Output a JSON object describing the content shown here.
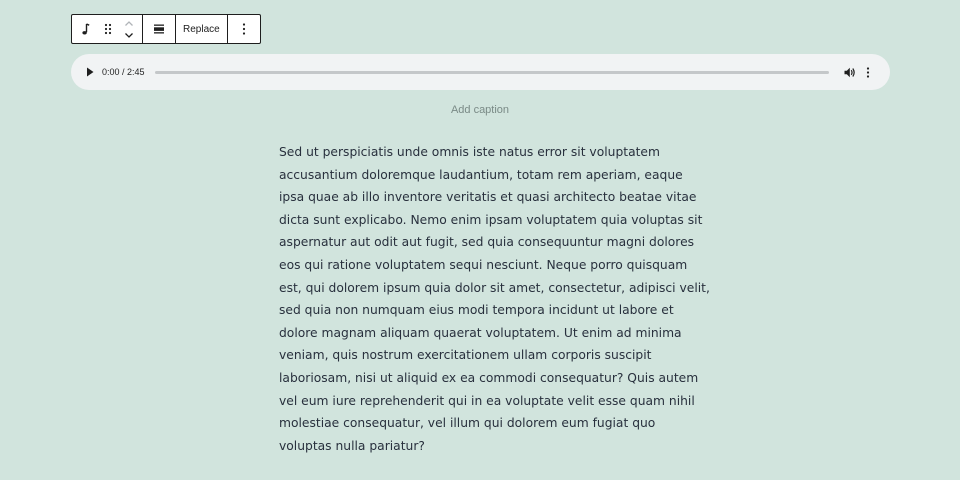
{
  "toolbar": {
    "block_type_icon": "music-note-icon",
    "drag_icon": "drag-handle-icon",
    "move_up_icon": "chevron-up-icon",
    "move_down_icon": "chevron-down-icon",
    "align_icon": "align-icon",
    "replace_label": "Replace",
    "more_icon": "more-vertical-icon"
  },
  "player": {
    "play_icon": "play-icon",
    "time": "0:00 / 2:45",
    "current": "0:00",
    "duration": "2:45",
    "progress": 0,
    "volume_icon": "volume-icon",
    "more_icon": "more-vertical-icon"
  },
  "caption": {
    "placeholder": "Add caption"
  },
  "paragraph": {
    "lines": [
      "Sed ut perspiciatis unde omnis iste natus error sit voluptatem",
      "accusantium doloremque laudantium, totam rem aperiam, eaque",
      "ipsa quae ab illo inventore veritatis et quasi architecto beatae vitae",
      "dicta sunt explicabo. Nemo enim ipsam voluptatem quia voluptas sit",
      "aspernatur aut odit aut fugit, sed quia consequuntur magni dolores",
      "eos qui ratione voluptatem sequi nesciunt. Neque porro quisquam",
      "est, qui dolorem ipsum quia dolor sit amet, consectetur, adipisci velit,",
      "sed quia non numquam eius modi tempora incidunt ut labore et",
      "dolore magnam aliquam quaerat voluptatem. Ut enim ad minima",
      "veniam, quis nostrum exercitationem ullam corporis suscipit",
      "laboriosam, nisi ut aliquid ex ea commodi consequatur? Quis autem",
      "vel eum iure reprehenderit qui in ea voluptate velit esse quam nihil",
      "molestiae consequatur, vel illum qui dolorem eum fugiat quo",
      "voluptas nulla pariatur?"
    ]
  },
  "colors": {
    "background": "#d1e4dd",
    "text": "#28303d",
    "player_bg": "#f1f3f4"
  }
}
